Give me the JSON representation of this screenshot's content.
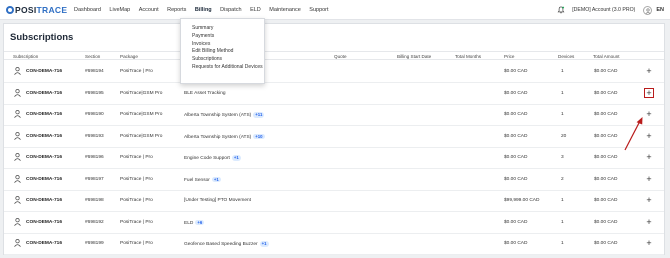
{
  "brand": {
    "name_part1": "POSI",
    "name_part2": "TRACE"
  },
  "nav": [
    "Dashboard",
    "LiveMap",
    "Account",
    "Reports",
    "Billing",
    "Dispatch",
    "ELD",
    "Maintenance",
    "Support"
  ],
  "topbar": {
    "account_label": "[DEMO] Account (3.0 PRO)",
    "language": "EN"
  },
  "page": {
    "title": "Subscriptions"
  },
  "billing_menu": [
    "Summary",
    "Payments",
    "Invoices",
    "Edit Billing Method",
    "Subscriptions",
    "Requests for Additional Devices"
  ],
  "table": {
    "headers": {
      "subscription": "Subscription",
      "section": "Section",
      "package": "Package",
      "quote": "Quote",
      "billing_start": "Billing Start Date",
      "total_months": "Total Months",
      "price": "Price",
      "devices": "Devices",
      "total_amount": "Total Amount"
    },
    "rows": [
      {
        "subscription": "CON-DEMA-716",
        "section": "#698194",
        "package": "PosiTrace | Pro",
        "addon": "",
        "badge": "",
        "price": "$0.00 CAD",
        "devices": "1",
        "total": "$0.00 CAD"
      },
      {
        "subscription": "CON-DEMA-716",
        "section": "#698195",
        "package": "PosiTrace|GSM Pro",
        "addon": "BLE Asset Tracking",
        "badge": "",
        "price": "$0.00 CAD",
        "devices": "1",
        "total": "$0.00 CAD"
      },
      {
        "subscription": "CON-DEMA-716",
        "section": "#698190",
        "package": "PosiTrace|GSM Pro",
        "addon": "Alberta Township System (ATS)",
        "badge": "+11",
        "price": "$0.00 CAD",
        "devices": "1",
        "total": "$0.00 CAD"
      },
      {
        "subscription": "CON-DEMA-716",
        "section": "#698193",
        "package": "PosiTrace|GSM Pro",
        "addon": "Alberta Township System (ATS)",
        "badge": "+10",
        "price": "$0.00 CAD",
        "devices": "20",
        "total": "$0.00 CAD"
      },
      {
        "subscription": "CON-DEMA-716",
        "section": "#698196",
        "package": "PosiTrace | Pro",
        "addon": "Engine Code Support",
        "badge": "+1",
        "price": "$0.00 CAD",
        "devices": "3",
        "total": "$0.00 CAD"
      },
      {
        "subscription": "CON-DEMA-716",
        "section": "#698197",
        "package": "PosiTrace | Pro",
        "addon": "Fuel Sensor",
        "badge": "+1",
        "price": "$0.00 CAD",
        "devices": "2",
        "total": "$0.00 CAD"
      },
      {
        "subscription": "CON-DEMA-716",
        "section": "#698198",
        "package": "PosiTrace | Pro",
        "addon": "[Under Testing] PTO Movement",
        "badge": "",
        "price": "$99,999.00 CAD",
        "devices": "1",
        "total": "$0.00 CAD"
      },
      {
        "subscription": "CON-DEMA-716",
        "section": "#698192",
        "package": "PosiTrace | Pro",
        "addon": "ELD",
        "badge": "+6",
        "price": "$0.00 CAD",
        "devices": "1",
        "total": "$0.00 CAD"
      },
      {
        "subscription": "CON-DEMA-716",
        "section": "#698199",
        "package": "PosiTrace | Pro",
        "addon": "Geofence Based Speeding Buzzer",
        "badge": "+1",
        "price": "$0.00 CAD",
        "devices": "1",
        "total": "$0.00 CAD"
      }
    ],
    "expand_symbol": "+"
  },
  "colors": {
    "brand": "#2f6fc4",
    "badge_bg": "#dbeafe",
    "badge_text": "#2563eb",
    "annotation": "#b91c1c"
  }
}
